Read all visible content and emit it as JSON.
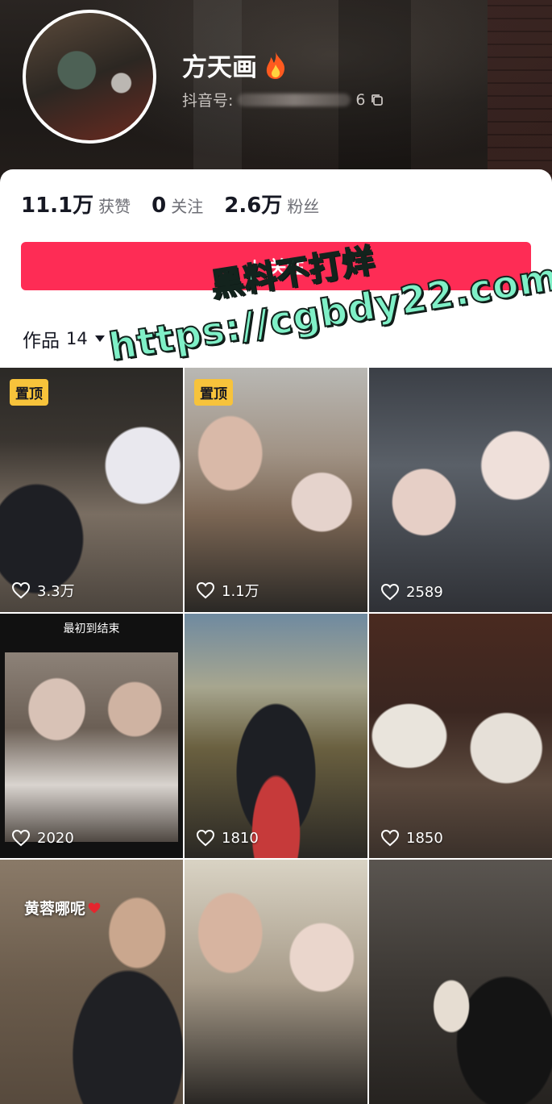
{
  "profile": {
    "nickname": "方天画",
    "douyin_id_label": "抖音号:",
    "douyin_id_suffix": "6",
    "badge_icon": "fire-icon"
  },
  "stats": {
    "likes_count": "11.1万",
    "likes_label": "获赞",
    "following_count": "0",
    "following_label": "关注",
    "followers_count": "2.6万",
    "followers_label": "粉丝"
  },
  "follow_button": {
    "label": "关注"
  },
  "works_tab": {
    "label": "作品",
    "count": "14"
  },
  "watermark": {
    "line1": "黑料不打烊",
    "line2": "https://cgbdy22.com"
  },
  "videos": [
    {
      "pinned_label": "置顶",
      "likes": "3.3万"
    },
    {
      "pinned_label": "置顶",
      "likes": "1.1万"
    },
    {
      "likes": "2589"
    },
    {
      "caption": "最初到结束",
      "likes": "2020"
    },
    {
      "likes": "1810"
    },
    {
      "likes": "1850"
    },
    {
      "overlay_text": "黄蓉哪呢"
    },
    {},
    {}
  ],
  "colors": {
    "accent": "#fe2c55",
    "pin_badge": "#f7c33b",
    "watermark": "#7ff0c7"
  }
}
